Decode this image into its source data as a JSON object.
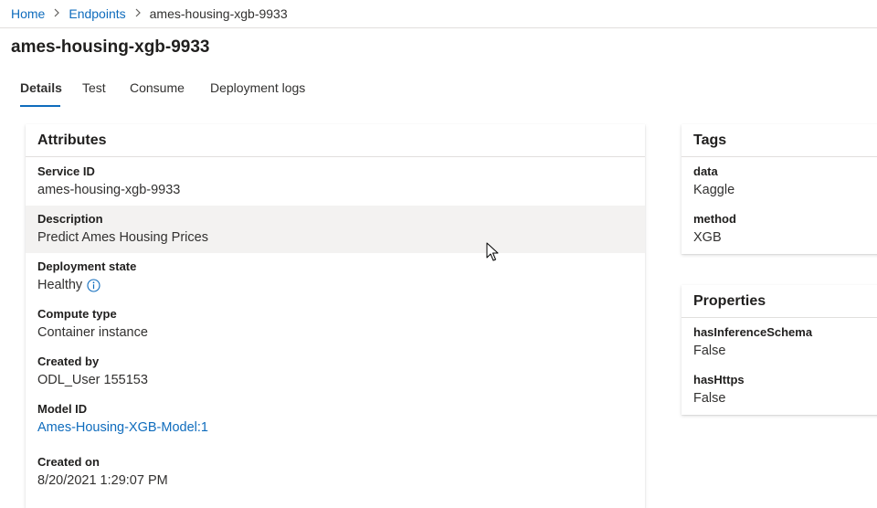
{
  "breadcrumb": {
    "items": [
      {
        "label": "Home"
      },
      {
        "label": "Endpoints"
      }
    ],
    "current": "ames-housing-xgb-9933"
  },
  "page": {
    "title": "ames-housing-xgb-9933"
  },
  "tabs": [
    {
      "label": "Details",
      "active": true
    },
    {
      "label": "Test",
      "active": false
    },
    {
      "label": "Consume",
      "active": false
    },
    {
      "label": "Deployment logs",
      "active": false
    }
  ],
  "attributes": {
    "title": "Attributes",
    "fields": [
      {
        "label": "Service ID",
        "value": "ames-housing-xgb-9933"
      },
      {
        "label": "Description",
        "value": "Predict Ames Housing Prices"
      },
      {
        "label": "Deployment state",
        "value": "Healthy",
        "icon": "info-icon"
      },
      {
        "label": "Compute type",
        "value": "Container instance"
      },
      {
        "label": "Created by",
        "value": "ODL_User 155153"
      },
      {
        "label": "Model ID",
        "value": "Ames-Housing-XGB-Model:1"
      },
      {
        "label": "Created on",
        "value": "8/20/2021 1:29:07 PM"
      }
    ]
  },
  "tags": {
    "title": "Tags",
    "fields": [
      {
        "label": "data",
        "value": "Kaggle"
      },
      {
        "label": "method",
        "value": "XGB"
      }
    ]
  },
  "properties": {
    "title": "Properties",
    "fields": [
      {
        "label": "hasInferenceSchema",
        "value": "False"
      },
      {
        "label": "hasHttps",
        "value": "False"
      }
    ]
  },
  "colors": {
    "accent": "#0f6cbd",
    "text": "#323130",
    "highlight_row": "#f3f2f1"
  }
}
